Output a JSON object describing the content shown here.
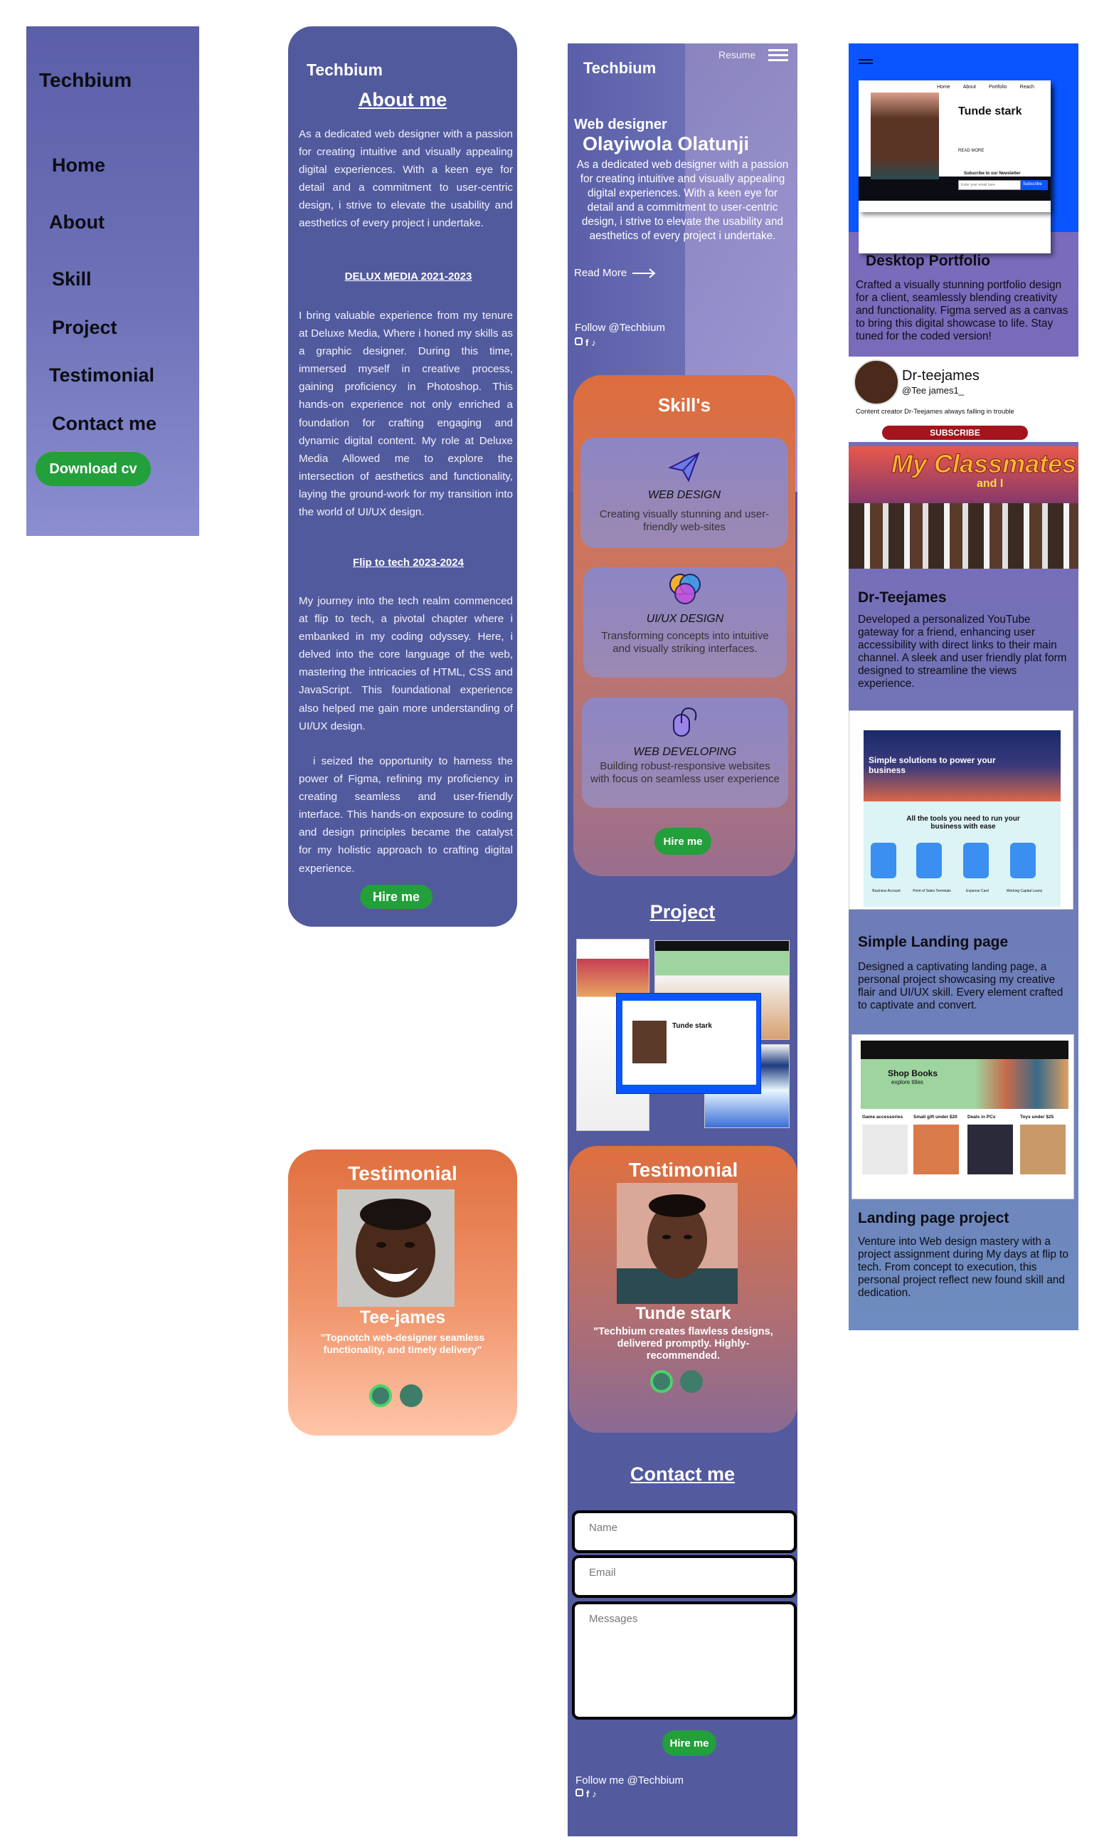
{
  "menu": {
    "brand": "Techbium",
    "items": [
      "Home",
      "About",
      "Skill",
      "Project",
      "Testimonial",
      "Contact me"
    ],
    "download": "Download cv"
  },
  "about": {
    "brand": "Techbium",
    "title": "About me",
    "intro": "As a dedicated web designer with a passion for creating intuitive and visually appealing digital experiences. With a keen eye for detail and a commitment to user-centric design, i strive to elevate the usability and aesthetics of every project i undertake.",
    "job1_title": "DELUX MEDIA 2021-2023",
    "job1_text": "I bring valuable experience from my tenure at Deluxe Media, Where i honed my skills as a graphic designer. During this time, immersed myself in creative process, gaining proficiency in Photoshop. This hands-on experience not only enriched a foundation for crafting engaging and dynamic digital content. My role at Deluxe Media Allowed me to explore the intersection of aesthetics and functionality, laying the ground-work for my transition into the world of UI/UX design.",
    "job2_title": "Flip to tech 2023-2024",
    "job2_text": "My journey into the tech realm commenced at flip to tech, a pivotal chapter where i embanked in my coding odyssey. Here, i delved into the core language of the web, mastering the intricacies of HTML, CSS and JavaScript. This foundational experience also helped me gain more understanding of UI/UX design.",
    "job2_text2": "i seized the opportunity to harness the power of Figma, refining my proficiency in creating seamless and user-friendly interface. This hands-on exposure to coding and design principles became the catalyst for my holistic approach to crafting digital experience.",
    "hire": "Hire me"
  },
  "testimonial_left": {
    "title": "Testimonial",
    "name": "Tee-james",
    "quote": "\"Topnotch web-designer seamless functionality, and timely delivery\""
  },
  "mobile": {
    "brand": "Techbium",
    "resume": "Resume",
    "role": "Web designer",
    "name": "Olayiwola Olatunji",
    "intro": "As a dedicated web designer with a passion for creating intuitive and visually appealing digital experiences. With a keen eye for detail and a commitment to user-centric design, i strive to elevate the usability and aesthetics of every project i undertake.",
    "read_more": "Read More",
    "follow": "Follow @Techbium",
    "skills_title": "Skill's",
    "skills": [
      {
        "title": "WEB DESIGN",
        "desc": "Creating visually stunning and user-friendly web-sites"
      },
      {
        "title": "UI/UX DESIGN",
        "desc": "Transforming concepts into intuitive and visually striking interfaces."
      },
      {
        "title": "WEB DEVELOPING",
        "desc": "Building robust-responsive websites with focus on seamless user experience"
      }
    ],
    "skills_hire": "Hire me",
    "project_title": "Project",
    "testimonial_title": "Testimonial",
    "testimonial_name": "Tunde stark",
    "testimonial_quote": "\"Techbium creates flawless designs, delivered promptly. Highly-recommended.",
    "contact_title": "Contact me",
    "name_placeholder": "Name",
    "email_placeholder": "Email",
    "message_placeholder": "Messages",
    "contact_hire": "Hire me",
    "follow_footer": "Follow me @Techbium"
  },
  "portfolio": {
    "desktop_shot": {
      "nav": [
        "Home",
        "About",
        "Portfolio",
        "Reach"
      ],
      "name": "Tunde stark",
      "newsletter": "Subscribe to our Newsletter",
      "email_placeholder": "Enter your email here",
      "subscribe": "Subscribe",
      "read_more": "READ MORE"
    },
    "desktop_title": "Desktop Portfolio",
    "desktop_text": "Crafted a visually stunning portfolio design for a client, seamlessly blending creativity and functionality. Figma served as a canvas to bring this digital showcase to life. Stay tuned for the coded version!",
    "yt_name": "Dr-teejames",
    "yt_handle": "@Tee james1_",
    "yt_desc": "Content creator Dr-Teejames always falling in trouble",
    "yt_subscribe": "SUBSCRIBE",
    "yt_banner": "My Classmates",
    "yt_banner_sub": "and I",
    "yt_title": "Dr-Teejames",
    "yt_text": "Developed a personalized YouTube gateway for a friend, enhancing user accessibility with direct links to their main channel. A sleek and user friendly plat form designed to streamline the views experience.",
    "landing_hero": "Simple solutions to power your business",
    "landing_tools": "All the tools you need to run your business with ease",
    "landing_items": [
      "Business Account",
      "Point of Sales Terminals",
      "Expense Card",
      "Working Capital Loans"
    ],
    "landing_title": "Simple Landing page",
    "landing_text": "Designed a captivating landing page, a personal project showcasing my creative flair and UI/UX skill. Every element crafted to captivate and convert.",
    "shop_title": "Shop Books",
    "shop_sub": "explore titles",
    "shop_cats": [
      "Game accessories",
      "Small gift under $20",
      "Deals in PCs",
      "Toys under $25"
    ],
    "lp_title": "Landing page project",
    "lp_text": "Venture into Web design mastery with a project assignment during My days at flip to tech. From concept to execution, this personal project reflect new found skill and dedication."
  },
  "colors": {
    "panel": "#525a9e",
    "accent_green": "#239f3b",
    "orange": "#e0703f",
    "blue": "#0a55ff"
  }
}
